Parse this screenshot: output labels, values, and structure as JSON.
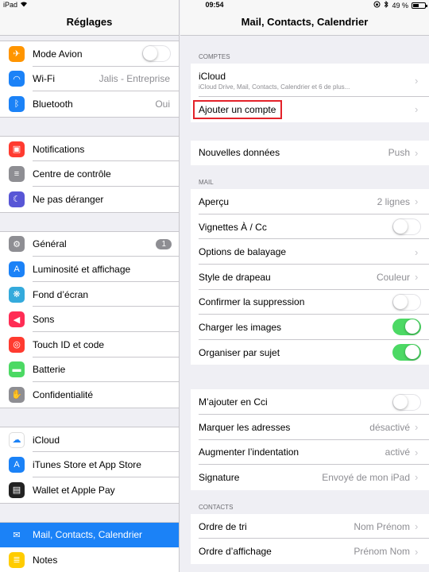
{
  "statusbar": {
    "device": "iPad",
    "time": "09:54",
    "battery": "49 %",
    "battery_level": 0.49
  },
  "left": {
    "title": "Réglages",
    "groups": [
      [
        {
          "label": "Mode Avion",
          "icon": "airplane-icon",
          "color": "#ff9500",
          "toggle": false
        },
        {
          "label": "Wi-Fi",
          "icon": "wifi-icon",
          "color": "#1b82f7",
          "value": "Jalis - Entreprise"
        },
        {
          "label": "Bluetooth",
          "icon": "bluetooth-icon",
          "color": "#1b82f7",
          "value": "Oui"
        }
      ],
      [
        {
          "label": "Notifications",
          "icon": "notifications-icon",
          "color": "#ff3b30"
        },
        {
          "label": "Centre de contrôle",
          "icon": "control-center-icon",
          "color": "#8e8e93"
        },
        {
          "label": "Ne pas déranger",
          "icon": "moon-icon",
          "color": "#5856d6"
        }
      ],
      [
        {
          "label": "Général",
          "icon": "gear-icon",
          "color": "#8e8e93",
          "badge": "1"
        },
        {
          "label": "Luminosité et affichage",
          "icon": "brightness-icon",
          "color": "#1b82f7"
        },
        {
          "label": "Fond d’écran",
          "icon": "wallpaper-icon",
          "color": "#34aadc"
        },
        {
          "label": "Sons",
          "icon": "speaker-icon",
          "color": "#ff2d55"
        },
        {
          "label": "Touch ID et code",
          "icon": "fingerprint-icon",
          "color": "#ff3b30"
        },
        {
          "label": "Batterie",
          "icon": "battery-icon",
          "color": "#4cd964"
        },
        {
          "label": "Confidentialité",
          "icon": "hand-icon",
          "color": "#8e8e93"
        }
      ],
      [
        {
          "label": "iCloud",
          "icon": "cloud-icon",
          "color": "#ffffff"
        },
        {
          "label": "iTunes Store et App Store",
          "icon": "app-store-icon",
          "color": "#1b82f7"
        },
        {
          "label": "Wallet et Apple Pay",
          "icon": "wallet-icon",
          "color": "#222222"
        }
      ],
      [
        {
          "label": "Mail, Contacts, Calendrier",
          "icon": "mail-icon",
          "color": "#1b82f7",
          "selected": true
        },
        {
          "label": "Notes",
          "icon": "notes-icon",
          "color": "#ffcc00"
        }
      ]
    ]
  },
  "right": {
    "title": "Mail, Contacts, Calendrier",
    "comptes_header": "COMPTES",
    "icloud": {
      "label": "iCloud",
      "sub": "iCloud Drive, Mail, Contacts, Calendrier et 6 de plus..."
    },
    "add_account": "Ajouter un compte",
    "new_data": {
      "label": "Nouvelles données",
      "value": "Push"
    },
    "mail_header": "MAIL",
    "mail": [
      {
        "label": "Aperçu",
        "value": "2 lignes",
        "chevron": true
      },
      {
        "label": "Vignettes À / Cc",
        "toggle": false
      },
      {
        "label": "Options de balayage",
        "value": "",
        "chevron": true
      },
      {
        "label": "Style de drapeau",
        "value": "Couleur",
        "chevron": true
      },
      {
        "label": "Confirmer la suppression",
        "toggle": false
      },
      {
        "label": "Charger les images",
        "toggle": true
      },
      {
        "label": "Organiser par sujet",
        "toggle": true
      }
    ],
    "mail2": [
      {
        "label": "M’ajouter en Cci",
        "toggle": false
      },
      {
        "label": "Marquer les adresses",
        "value": "désactivé",
        "chevron": true
      },
      {
        "label": "Augmenter l’indentation",
        "value": "activé",
        "chevron": true
      },
      {
        "label": "Signature",
        "value": "Envoyé de mon iPad",
        "chevron": true
      }
    ],
    "contacts_header": "CONTACTS",
    "contacts": [
      {
        "label": "Ordre de tri",
        "value": "Nom Prénom",
        "chevron": true
      },
      {
        "label": "Ordre d’affichage",
        "value": "Prénom Nom",
        "chevron": true
      }
    ]
  }
}
